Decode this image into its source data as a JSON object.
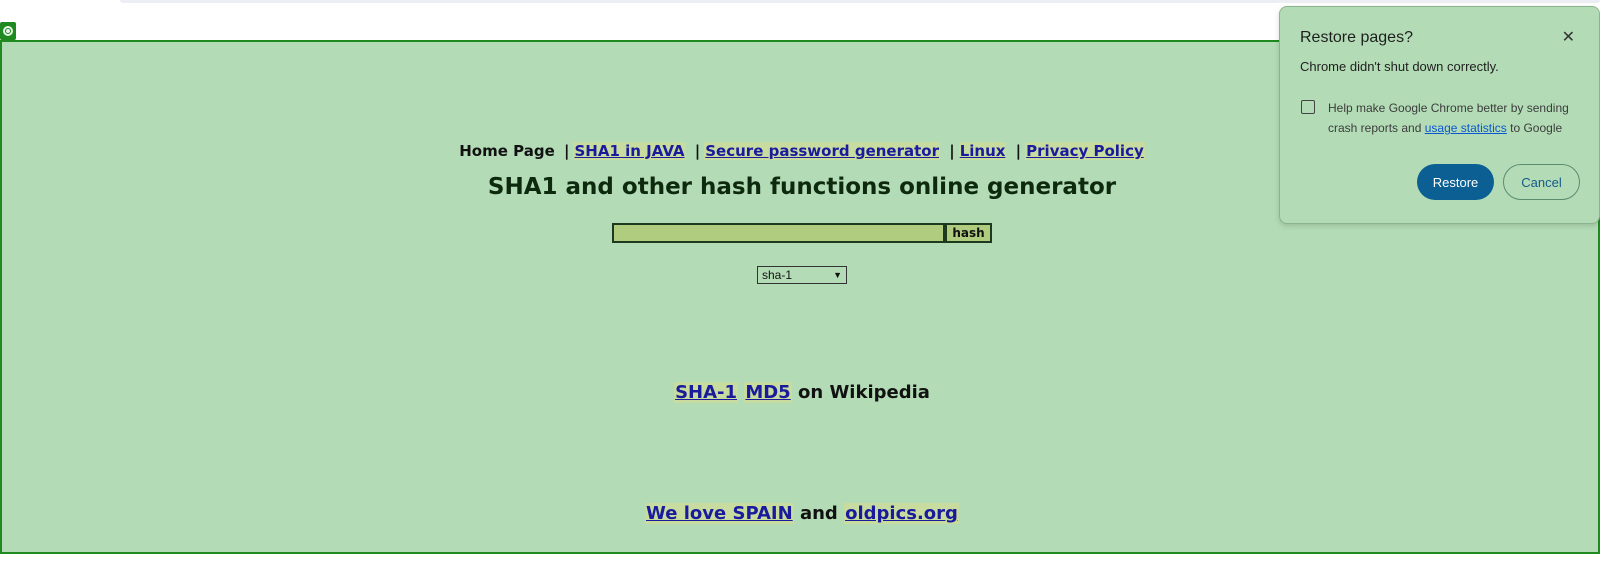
{
  "nav": {
    "home": "Home Page",
    "sep": "|",
    "sha1_java": "SHA1 in JAVA",
    "password_gen": "Secure password generator",
    "linux": "Linux",
    "privacy": "Privacy Policy"
  },
  "title": "SHA1 and other hash functions online generator",
  "form": {
    "input_value": "",
    "hash_button": "hash",
    "algorithm_selected": "sha-1"
  },
  "wiki": {
    "sha1": "SHA-1",
    "md5": "MD5",
    "suffix": "on Wikipedia"
  },
  "footer": {
    "spain": "We love SPAIN",
    "and": "and",
    "oldpics": "oldpics.org"
  },
  "popup": {
    "title": "Restore pages?",
    "message": "Chrome didn't shut down correctly.",
    "checkbox_text_before": "Help make Google Chrome better by sending crash reports and",
    "checkbox_link": "usage statistics",
    "checkbox_text_after": "to Google",
    "restore": "Restore",
    "cancel": "Cancel",
    "close_glyph": "✕"
  },
  "colors": {
    "page_bg": "#b3dcb6",
    "border": "#1f8a1f",
    "link": "#1a1a9c",
    "restore_btn": "#0b5f93"
  }
}
